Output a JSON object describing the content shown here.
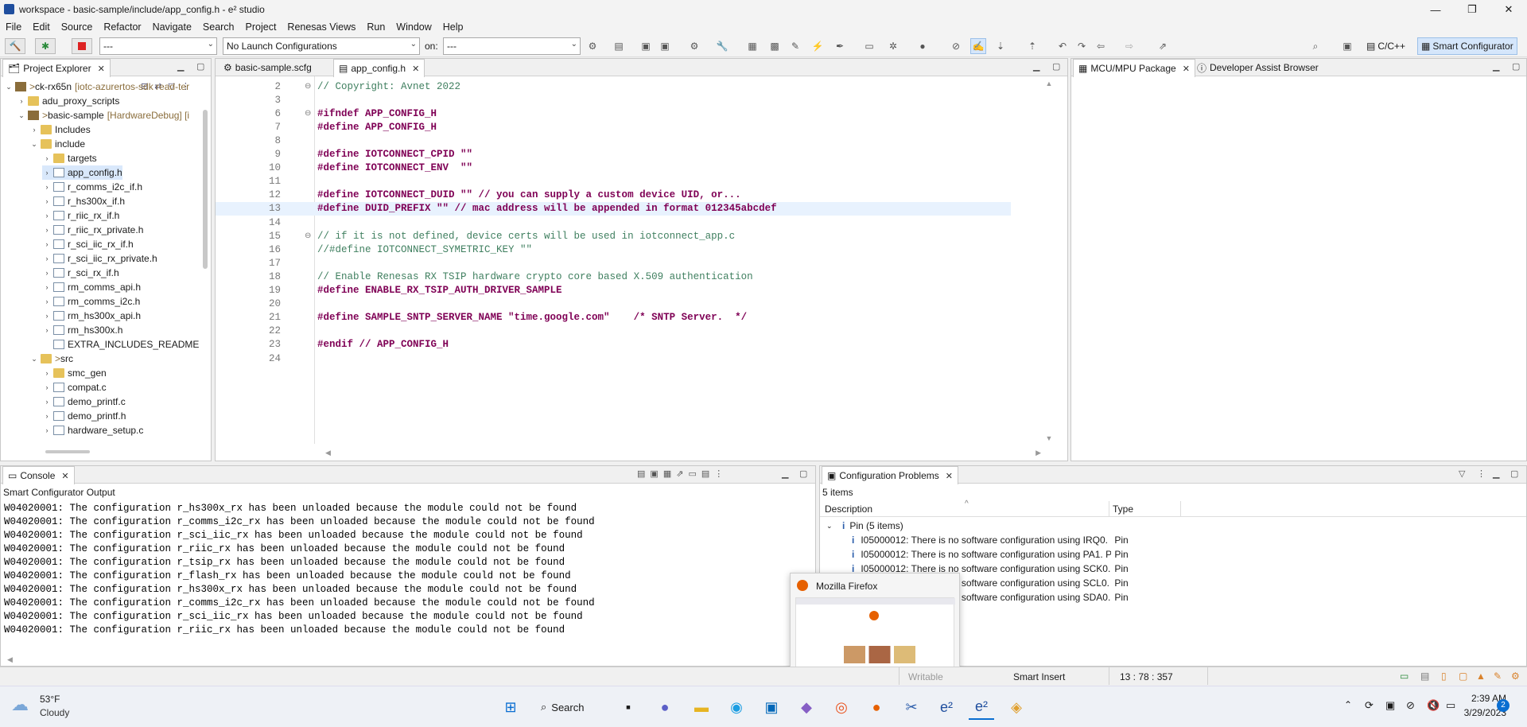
{
  "window": {
    "title": "workspace - basic-sample/include/app_config.h - e² studio"
  },
  "menu": [
    "File",
    "Edit",
    "Source",
    "Refactor",
    "Navigate",
    "Search",
    "Project",
    "Renesas Views",
    "Run",
    "Window",
    "Help"
  ],
  "toolbar": {
    "config_combo": "---",
    "launch_combo": "No Launch Configurations",
    "on_label": "on:",
    "target_combo": "---",
    "persp_cpp": "C/C++",
    "persp_smart": "Smart Configurator"
  },
  "project_explorer": {
    "title": "Project Explorer",
    "items": [
      {
        "label": "ck-rx65n",
        "deco": "[iotc-azurertos-sdk read-ter",
        "level": 0
      },
      {
        "label": "adu_proxy_scripts",
        "deco": "",
        "level": 1
      },
      {
        "label": "basic-sample",
        "deco": "[HardwareDebug] [i",
        "level": 1
      },
      {
        "label": "Includes",
        "deco": "",
        "level": 2
      },
      {
        "label": "include",
        "deco": "",
        "level": 2
      },
      {
        "label": "targets",
        "deco": "",
        "level": 3
      },
      {
        "label": "app_config.h",
        "deco": "",
        "level": 3
      },
      {
        "label": "r_comms_i2c_if.h",
        "deco": "",
        "level": 3
      },
      {
        "label": "r_hs300x_if.h",
        "deco": "",
        "level": 3
      },
      {
        "label": "r_riic_rx_if.h",
        "deco": "",
        "level": 3
      },
      {
        "label": "r_riic_rx_private.h",
        "deco": "",
        "level": 3
      },
      {
        "label": "r_sci_iic_rx_if.h",
        "deco": "",
        "level": 3
      },
      {
        "label": "r_sci_iic_rx_private.h",
        "deco": "",
        "level": 3
      },
      {
        "label": "r_sci_rx_if.h",
        "deco": "",
        "level": 3
      },
      {
        "label": "rm_comms_api.h",
        "deco": "",
        "level": 3
      },
      {
        "label": "rm_comms_i2c.h",
        "deco": "",
        "level": 3
      },
      {
        "label": "rm_hs300x_api.h",
        "deco": "",
        "level": 3
      },
      {
        "label": "rm_hs300x.h",
        "deco": "",
        "level": 3
      },
      {
        "label": "EXTRA_INCLUDES_README",
        "deco": "",
        "level": 3
      },
      {
        "label": "src",
        "deco": "",
        "level": 2
      },
      {
        "label": "smc_gen",
        "deco": "",
        "level": 3
      },
      {
        "label": "compat.c",
        "deco": "",
        "level": 3
      },
      {
        "label": "demo_printf.c",
        "deco": "",
        "level": 3
      },
      {
        "label": "demo_printf.h",
        "deco": "",
        "level": 3
      },
      {
        "label": "hardware_setup.c",
        "deco": "",
        "level": 3
      }
    ]
  },
  "editor": {
    "tabs": [
      "basic-sample.scfg",
      "app_config.h"
    ],
    "lines": [
      {
        "n": "2",
        "text": "// Copyright: Avnet 2022",
        "cls": "cm"
      },
      {
        "n": "3",
        "text": "",
        "cls": ""
      },
      {
        "n": "6",
        "text": "#ifndef APP_CONFIG_H",
        "cls": "pp"
      },
      {
        "n": "7",
        "text": "#define APP_CONFIG_H",
        "cls": "pp"
      },
      {
        "n": "8",
        "text": "",
        "cls": ""
      },
      {
        "n": "9",
        "text": "#define IOTCONNECT_CPID \"\"",
        "cls": "pp"
      },
      {
        "n": "10",
        "text": "#define IOTCONNECT_ENV  \"\"",
        "cls": "pp"
      },
      {
        "n": "11",
        "text": "",
        "cls": ""
      },
      {
        "n": "12",
        "text": "#define IOTCONNECT_DUID \"\" // you can supply a custom device UID, or...",
        "cls": "pp"
      },
      {
        "n": "13",
        "text": "#define DUID_PREFIX \"\" // mac address will be appended in format 012345abcdef",
        "cls": "pp"
      },
      {
        "n": "14",
        "text": "",
        "cls": ""
      },
      {
        "n": "15",
        "text": "// if it is not defined, device certs will be used in iotconnect_app.c",
        "cls": "cm"
      },
      {
        "n": "16",
        "text": "//#define IOTCONNECT_SYMETRIC_KEY \"\"",
        "cls": "cm"
      },
      {
        "n": "17",
        "text": "",
        "cls": ""
      },
      {
        "n": "18",
        "text": "// Enable Renesas RX TSIP hardware crypto core based X.509 authentication",
        "cls": "cm"
      },
      {
        "n": "19",
        "text": "#define ENABLE_RX_TSIP_AUTH_DRIVER_SAMPLE",
        "cls": "pp"
      },
      {
        "n": "20",
        "text": "",
        "cls": ""
      },
      {
        "n": "21",
        "text": "#define SAMPLE_SNTP_SERVER_NAME \"time.google.com\"    /* SNTP Server.  */",
        "cls": "pp"
      },
      {
        "n": "22",
        "text": "",
        "cls": ""
      },
      {
        "n": "23",
        "text": "#endif // APP_CONFIG_H",
        "cls": "pp"
      },
      {
        "n": "24",
        "text": "",
        "cls": ""
      }
    ]
  },
  "right_panel": {
    "tabs": [
      "MCU/MPU Package",
      "Developer Assist Browser"
    ]
  },
  "console": {
    "title": "Console",
    "subtitle": "Smart Configurator Output",
    "lines": [
      "W04020001: The configuration r_hs300x_rx has been unloaded because the module could not be found",
      "W04020001: The configuration r_comms_i2c_rx has been unloaded because the module could not be found",
      "W04020001: The configuration r_sci_iic_rx has been unloaded because the module could not be found",
      "W04020001: The configuration r_riic_rx has been unloaded because the module could not be found",
      "W04020001: The configuration r_tsip_rx has been unloaded because the module could not be found",
      "W04020001: The configuration r_flash_rx has been unloaded because the module could not be found",
      "W04020001: The configuration r_hs300x_rx has been unloaded because the module could not be found",
      "W04020001: The configuration r_comms_i2c_rx has been unloaded because the module could not be found",
      "W04020001: The configuration r_sci_iic_rx has been unloaded because the module could not be found",
      "W04020001: The configuration r_riic_rx has been unloaded because the module could not be found"
    ]
  },
  "config_problems": {
    "title": "Configuration Problems",
    "count": "5 items",
    "col_description": "Description",
    "col_type": "Type",
    "group": "Pin (5 items)",
    "rows": [
      {
        "desc": "I05000012: There is no software configuration using IRQ0. I",
        "type": "Pin"
      },
      {
        "desc": "I05000012: There is no software configuration using PA1. P",
        "type": "Pin"
      },
      {
        "desc": "I05000012: There is no software configuration using SCK0.",
        "type": "Pin"
      },
      {
        "desc": "I05000012: There is no software configuration using SCL0.",
        "type": "Pin"
      },
      {
        "desc": "I05000012: There is no software configuration using SDA0.",
        "type": "Pin"
      }
    ]
  },
  "firefox_preview": {
    "title": "Mozilla Firefox"
  },
  "statusbar": {
    "insert_mode": "Smart Insert",
    "position": "13 : 78 : 357",
    "writable": "Writable"
  },
  "taskbar": {
    "weather_temp": "53°F",
    "weather_desc": "Cloudy",
    "search": "Search",
    "time": "2:39 AM",
    "date": "3/29/2023",
    "badge": "2"
  }
}
